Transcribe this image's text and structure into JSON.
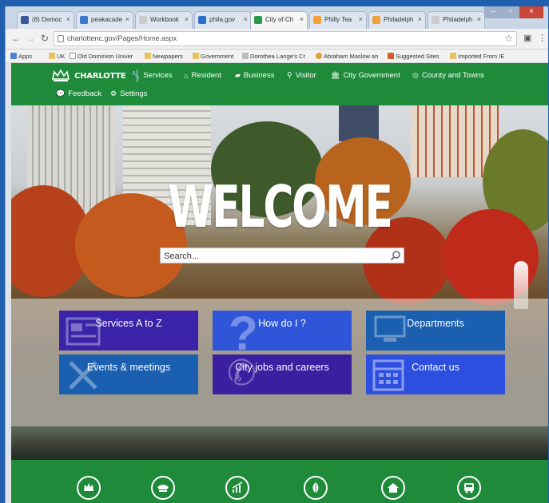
{
  "browser": {
    "tabs": [
      {
        "label": "(8) Democ",
        "icon": "facebook-favicon",
        "color": "#3b5998",
        "active": false
      },
      {
        "label": "peakacade",
        "icon": "pacman-favicon",
        "color": "#3a78d2",
        "active": false
      },
      {
        "label": "Workbook",
        "icon": "page-favicon",
        "color": "#cccccc",
        "active": false
      },
      {
        "label": "phila.gov",
        "icon": "phila-favicon",
        "color": "#2a6fc9",
        "active": false
      },
      {
        "label": "City of Ch",
        "icon": "charlotte-favicon",
        "color": "#2a9a4a",
        "active": true
      },
      {
        "label": "Philly Tea",
        "icon": "doc-favicon",
        "color": "#f2a13a",
        "active": false
      },
      {
        "label": "Philadelph",
        "icon": "doc-favicon",
        "color": "#f2a13a",
        "active": false
      },
      {
        "label": "Philadelph",
        "icon": "page-favicon",
        "color": "#cccccc",
        "active": false
      }
    ],
    "url": "charlottenc.gov/Pages/Home.aspx",
    "bookmarks": [
      "Apps",
      "UK",
      "Old Dominion Univer",
      "Newpapers",
      "Government",
      "Dorothea Lange's Cr",
      "Abraham Maslow an",
      "Suggested Sites",
      "Imported From IE"
    ]
  },
  "site": {
    "logo_text": "CHARLOTTE",
    "nav": [
      {
        "label": "Services",
        "icon": "wrench-icon"
      },
      {
        "label": "Resident",
        "icon": "home-icon"
      },
      {
        "label": "Business",
        "icon": "briefcase-icon"
      },
      {
        "label": "Visitor",
        "icon": "map-pin-icon"
      },
      {
        "label": "City Government",
        "icon": "government-building-icon"
      },
      {
        "label": "County and Towns",
        "icon": "globe-icon"
      }
    ],
    "nav2": [
      {
        "label": "Feedback",
        "icon": "comment-icon"
      },
      {
        "label": "Settings",
        "icon": "gear-icon"
      }
    ],
    "hero_title": "WELCOME",
    "search_placeholder": "Search...",
    "tiles": [
      {
        "label": "Services A to Z",
        "icon": "newspaper-icon",
        "color": "#3a23a8"
      },
      {
        "label": "How do I ?",
        "icon": "question-mark-icon",
        "color": "#2f55d9"
      },
      {
        "label": "Departments",
        "icon": "monitor-icon",
        "color": "#1a5fb0"
      },
      {
        "label": "Events & meetings",
        "icon": "tools-icon",
        "color": "#1a5fb0"
      },
      {
        "label": "City jobs and careers",
        "icon": "phone-icon",
        "color": "#3a1fa0"
      },
      {
        "label": "Contact us",
        "icon": "calendar-icon",
        "color": "#2c4fe0"
      }
    ],
    "footer_icons": [
      "crown-icon",
      "police-hat-icon",
      "growth-chart-icon",
      "leaf-icon",
      "house-icon",
      "bus-icon"
    ]
  }
}
